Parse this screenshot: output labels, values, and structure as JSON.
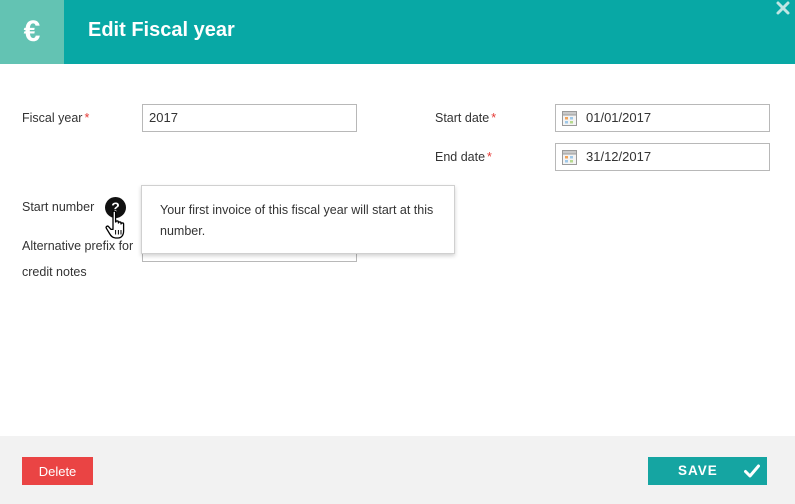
{
  "header": {
    "icon": "euro-icon",
    "icon_glyph": "€",
    "title": "Edit Fiscal year",
    "close_icon": "close-icon"
  },
  "form": {
    "fiscal_year": {
      "label": "Fiscal year",
      "required_mark": "*",
      "value": "2017"
    },
    "start_date": {
      "label": "Start date",
      "required_mark": "*",
      "value": "01/01/2017"
    },
    "end_date": {
      "label": "End date",
      "required_mark": "*",
      "value": "31/12/2017"
    },
    "start_number": {
      "label": "Start number",
      "help_glyph": "?"
    },
    "alt_prefix": {
      "label_line1": "Alternative prefix for",
      "label_line2": "credit notes"
    }
  },
  "tooltip": {
    "text": "Your first invoice of this fiscal year will start at this number."
  },
  "footer": {
    "delete_label": "Delete",
    "save_label": "SAVE"
  },
  "colors": {
    "header_bg": "#08a8a5",
    "header_icon_bg": "#63c3b3",
    "delete_bg": "#ea4444",
    "save_bg": "#15a5a2",
    "required": "#e53935"
  }
}
